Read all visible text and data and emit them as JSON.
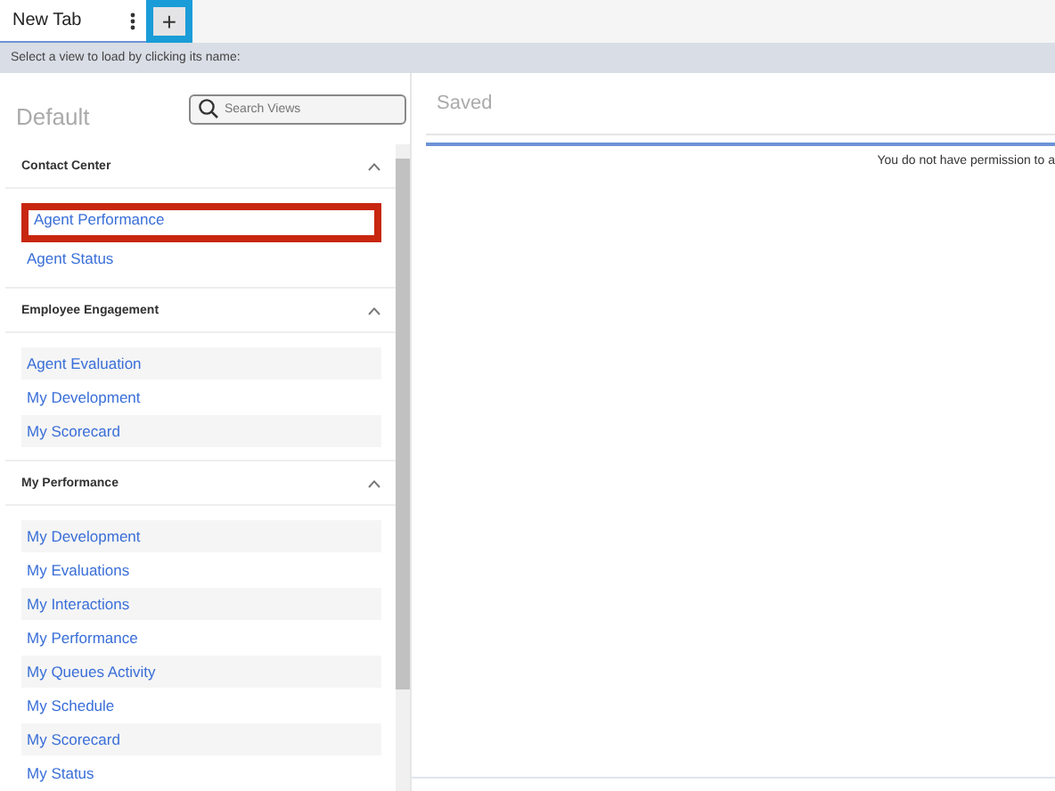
{
  "tabs": [
    {
      "label": "New Tab",
      "selected": true
    }
  ],
  "add_tab": {
    "label": "+",
    "highlighted": true
  },
  "hint": "Select a view to load by clicking its name:",
  "left_panel": {
    "title": "Default",
    "search": {
      "placeholder": "Search Views"
    },
    "sections": [
      {
        "title": "Contact Center",
        "expanded": true,
        "striped": false,
        "items": [
          {
            "label": "Agent Performance",
            "highlighted": true
          },
          {
            "label": "Agent Status",
            "highlighted": false
          }
        ]
      },
      {
        "title": "Employee Engagement",
        "expanded": true,
        "striped": true,
        "items": [
          {
            "label": "Agent Evaluation",
            "highlighted": false
          },
          {
            "label": "My Development",
            "highlighted": false
          },
          {
            "label": "My Scorecard",
            "highlighted": false
          }
        ]
      },
      {
        "title": "My Performance",
        "expanded": true,
        "striped": true,
        "items": [
          {
            "label": "My Development",
            "highlighted": false
          },
          {
            "label": "My Evaluations",
            "highlighted": false
          },
          {
            "label": "My Interactions",
            "highlighted": false
          },
          {
            "label": "My Performance",
            "highlighted": false
          },
          {
            "label": "My Queues Activity",
            "highlighted": false
          },
          {
            "label": "My Schedule",
            "highlighted": false
          },
          {
            "label": "My Scorecard",
            "highlighted": false
          },
          {
            "label": "My Status",
            "highlighted": false
          }
        ]
      }
    ]
  },
  "right_panel": {
    "title": "Saved",
    "message": "You do not have permission to a"
  }
}
